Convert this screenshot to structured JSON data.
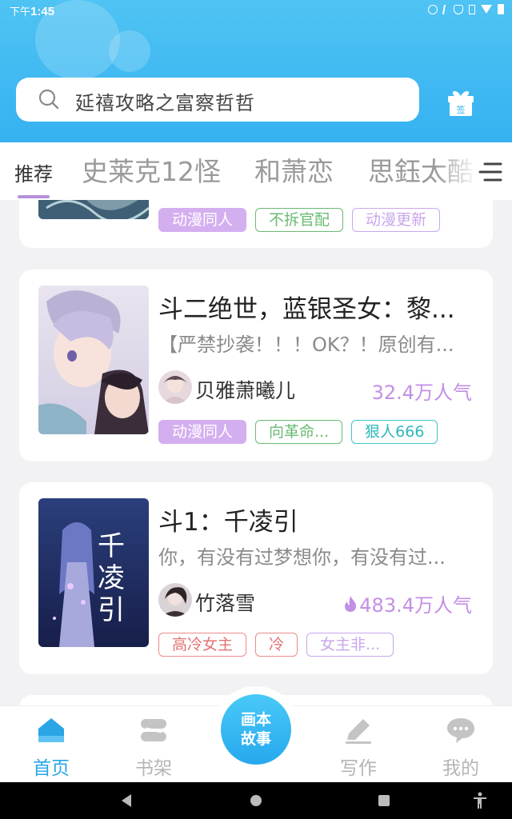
{
  "status_bar": {
    "time_prefix": "下午",
    "time": "1:45"
  },
  "header": {
    "search_placeholder": "延禧攻略之富察哲哲",
    "gift_label": "签"
  },
  "tabs": [
    {
      "label": "推荐",
      "active": true
    },
    {
      "label": "史莱克12怪",
      "active": false
    },
    {
      "label": "和萧恋",
      "active": false
    },
    {
      "label": "思鈺太酷",
      "active": false
    }
  ],
  "cards": [
    {
      "title": "",
      "tags": [
        {
          "label": "动漫同人",
          "style": "filled"
        },
        {
          "label": "不拆官配",
          "style": "green"
        },
        {
          "label": "动漫更新",
          "style": "purple"
        }
      ]
    },
    {
      "title": "斗二绝世，蓝银圣女：黎...",
      "desc": "【严禁抄袭！！！OK？！原创有...",
      "author": "贝雅萧曦儿",
      "popularity": "32.4万人气",
      "tags": [
        {
          "label": "动漫同人",
          "style": "filled"
        },
        {
          "label": "向革命...",
          "style": "green"
        },
        {
          "label": "狠人666",
          "style": "teal"
        }
      ]
    },
    {
      "title": "斗1：千凌引",
      "desc": "你，有没有过梦想你，有没有过...",
      "author": "竹落雪",
      "popularity": "483.4万人气",
      "cover_text": "千凌引",
      "tags": [
        {
          "label": "高冷女主",
          "style": "red"
        },
        {
          "label": "冷",
          "style": "red"
        },
        {
          "label": "女主非...",
          "style": "purple"
        }
      ]
    }
  ],
  "bottom_nav": {
    "home": "首页",
    "shelf": "书架",
    "center_line1": "画本",
    "center_line2": "故事",
    "write": "写作",
    "mine": "我的"
  },
  "colors": {
    "header_blue": "#35b2f1",
    "accent_purple": "#c38fe6",
    "nav_active": "#2aa5e6"
  }
}
